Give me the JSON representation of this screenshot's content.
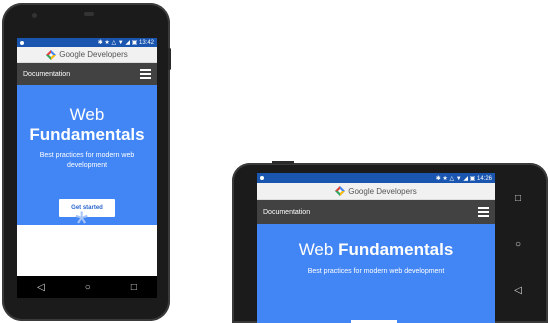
{
  "portrait": {
    "status_time": "13:42",
    "status_icons": "✱ ★ △ ▼ ◢ ▣",
    "brand": "Google Developers",
    "nav_title": "Documentation",
    "hero_title_light": "Web ",
    "hero_title_bold": "Fundamentals",
    "hero_subtitle": "Best practices for modern web development",
    "cta_label": "Get started",
    "asterisk": "*",
    "nav_back": "◁",
    "nav_home": "○",
    "nav_recent": "□"
  },
  "landscape": {
    "status_time": "14:26",
    "status_icons": "✱ ★ △ ▼ ◢ ▣",
    "brand": "Google Developers",
    "nav_title": "Documentation",
    "hero_title_light": "Web ",
    "hero_title_bold": "Fundamentals",
    "hero_subtitle": "Best practices for modern web development",
    "nav_recent": "□",
    "nav_home": "○",
    "nav_back": "◁"
  },
  "colors": {
    "hero_blue": "#4285f4",
    "status_blue": "#1a56b0",
    "toolbar_dark": "#424242"
  }
}
